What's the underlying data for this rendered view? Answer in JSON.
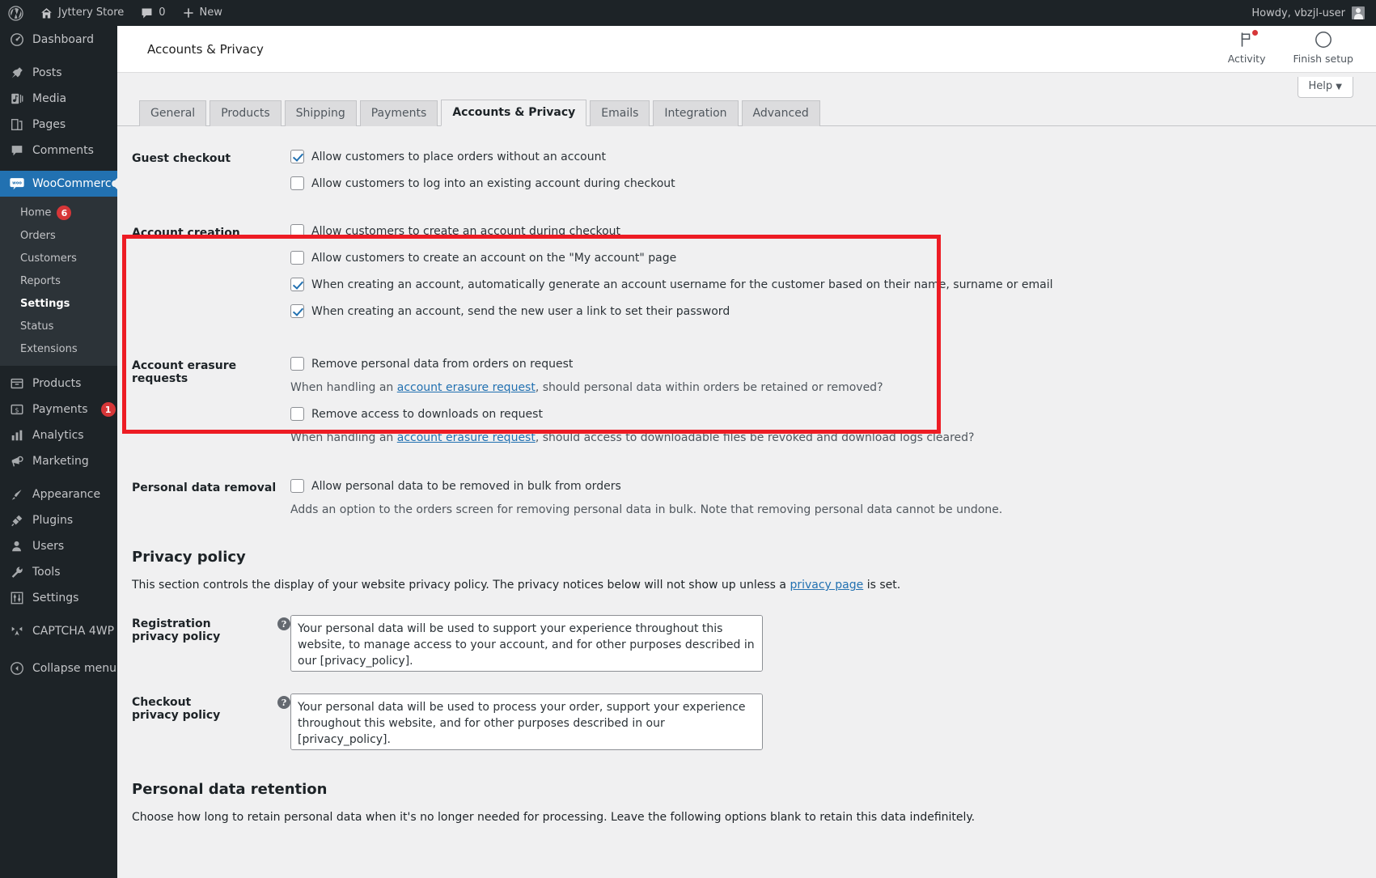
{
  "adminbar": {
    "wp_logo": "wordpress-logo",
    "site_name": "Jyttery Store",
    "comments_count": "0",
    "new_label": "New",
    "howdy": "Howdy, vbzjl-user"
  },
  "sidebar": {
    "items": [
      {
        "label": "Dashboard",
        "icon": "dashboard-icon",
        "current": false
      },
      {
        "label": "Posts",
        "icon": "pin-icon",
        "current": false
      },
      {
        "label": "Media",
        "icon": "media-icon",
        "current": false
      },
      {
        "label": "Pages",
        "icon": "pages-icon",
        "current": false
      },
      {
        "label": "Comments",
        "icon": "comments-icon",
        "current": false
      },
      {
        "label": "WooCommerce",
        "icon": "woocommerce-icon",
        "current": true
      },
      {
        "label": "Products",
        "icon": "products-icon",
        "current": false
      },
      {
        "label": "Payments",
        "icon": "payments-icon",
        "current": false,
        "badge": "1"
      },
      {
        "label": "Analytics",
        "icon": "analytics-icon",
        "current": false
      },
      {
        "label": "Marketing",
        "icon": "megaphone-icon",
        "current": false
      },
      {
        "label": "Appearance",
        "icon": "brush-icon",
        "current": false
      },
      {
        "label": "Plugins",
        "icon": "plugin-icon",
        "current": false
      },
      {
        "label": "Users",
        "icon": "users-icon",
        "current": false
      },
      {
        "label": "Tools",
        "icon": "wrench-icon",
        "current": false
      },
      {
        "label": "Settings",
        "icon": "settings-sliders-icon",
        "current": false
      },
      {
        "label": "CAPTCHA 4WP",
        "icon": "captcha-icon",
        "current": false
      },
      {
        "label": "Collapse menu",
        "icon": "collapse-icon",
        "current": false
      }
    ],
    "submenu": [
      {
        "label": "Home",
        "badge": "6",
        "current": false
      },
      {
        "label": "Orders",
        "current": false
      },
      {
        "label": "Customers",
        "current": false
      },
      {
        "label": "Reports",
        "current": false
      },
      {
        "label": "Settings",
        "current": true
      },
      {
        "label": "Status",
        "current": false
      },
      {
        "label": "Extensions",
        "current": false
      }
    ]
  },
  "header": {
    "title": "Accounts & Privacy",
    "activity_label": "Activity",
    "finish_setup_label": "Finish setup",
    "help_label": "Help",
    "help_caret": "▼"
  },
  "tabs": [
    {
      "label": "General",
      "active": false
    },
    {
      "label": "Products",
      "active": false
    },
    {
      "label": "Shipping",
      "active": false
    },
    {
      "label": "Payments",
      "active": false
    },
    {
      "label": "Accounts & Privacy",
      "active": true
    },
    {
      "label": "Emails",
      "active": false
    },
    {
      "label": "Integration",
      "active": false
    },
    {
      "label": "Advanced",
      "active": false
    }
  ],
  "settings": {
    "guest_checkout": {
      "label": "Guest checkout",
      "options": [
        {
          "label": "Allow customers to place orders without an account",
          "checked": true
        },
        {
          "label": "Allow customers to log into an existing account during checkout",
          "checked": false
        }
      ]
    },
    "account_creation": {
      "label": "Account creation",
      "options": [
        {
          "label": "Allow customers to create an account during checkout",
          "checked": false
        },
        {
          "label": "Allow customers to create an account on the \"My account\" page",
          "checked": false
        },
        {
          "label": "When creating an account, automatically generate an account username for the customer based on their name, surname or email",
          "checked": true
        },
        {
          "label": "When creating an account, send the new user a link to set their password",
          "checked": true
        }
      ]
    },
    "account_erasure": {
      "label": "Account erasure requests",
      "option1": "Remove personal data from orders on request",
      "option1_checked": false,
      "desc1_pre": "When handling an ",
      "desc1_link": "account erasure request",
      "desc1_post": ", should personal data within orders be retained or removed?",
      "option2": "Remove access to downloads on request",
      "option2_checked": false,
      "desc2_pre": "When handling an ",
      "desc2_link": "account erasure request",
      "desc2_post": ", should access to downloadable files be revoked and download logs cleared?"
    },
    "personal_data_removal": {
      "label": "Personal data removal",
      "option": "Allow personal data to be removed in bulk from orders",
      "option_checked": false,
      "desc": "Adds an option to the orders screen for removing personal data in bulk. Note that removing personal data cannot be undone."
    },
    "privacy_policy": {
      "heading": "Privacy policy",
      "desc_pre": "This section controls the display of your website privacy policy. The privacy notices below will not show up unless a ",
      "desc_link": "privacy page",
      "desc_post": " is set.",
      "registration_label": "Registration privacy policy",
      "registration_value": "Your personal data will be used to support your experience throughout this website, to manage access to your account, and for other purposes described in our [privacy_policy].",
      "checkout_label": "Checkout privacy policy",
      "checkout_value": "Your personal data will be used to process your order, support your experience throughout this website, and for other purposes described in our [privacy_policy]."
    },
    "personal_data_retention": {
      "heading": "Personal data retention",
      "desc": "Choose how long to retain personal data when it's no longer needed for processing. Leave the following options blank to retain this data indefinitely."
    }
  },
  "colors": {
    "wp_dark": "#1d2327",
    "wp_blue": "#2271b1",
    "badge_red": "#d63638",
    "highlight_red": "#ed1c24",
    "page_bg": "#f0f0f1"
  }
}
